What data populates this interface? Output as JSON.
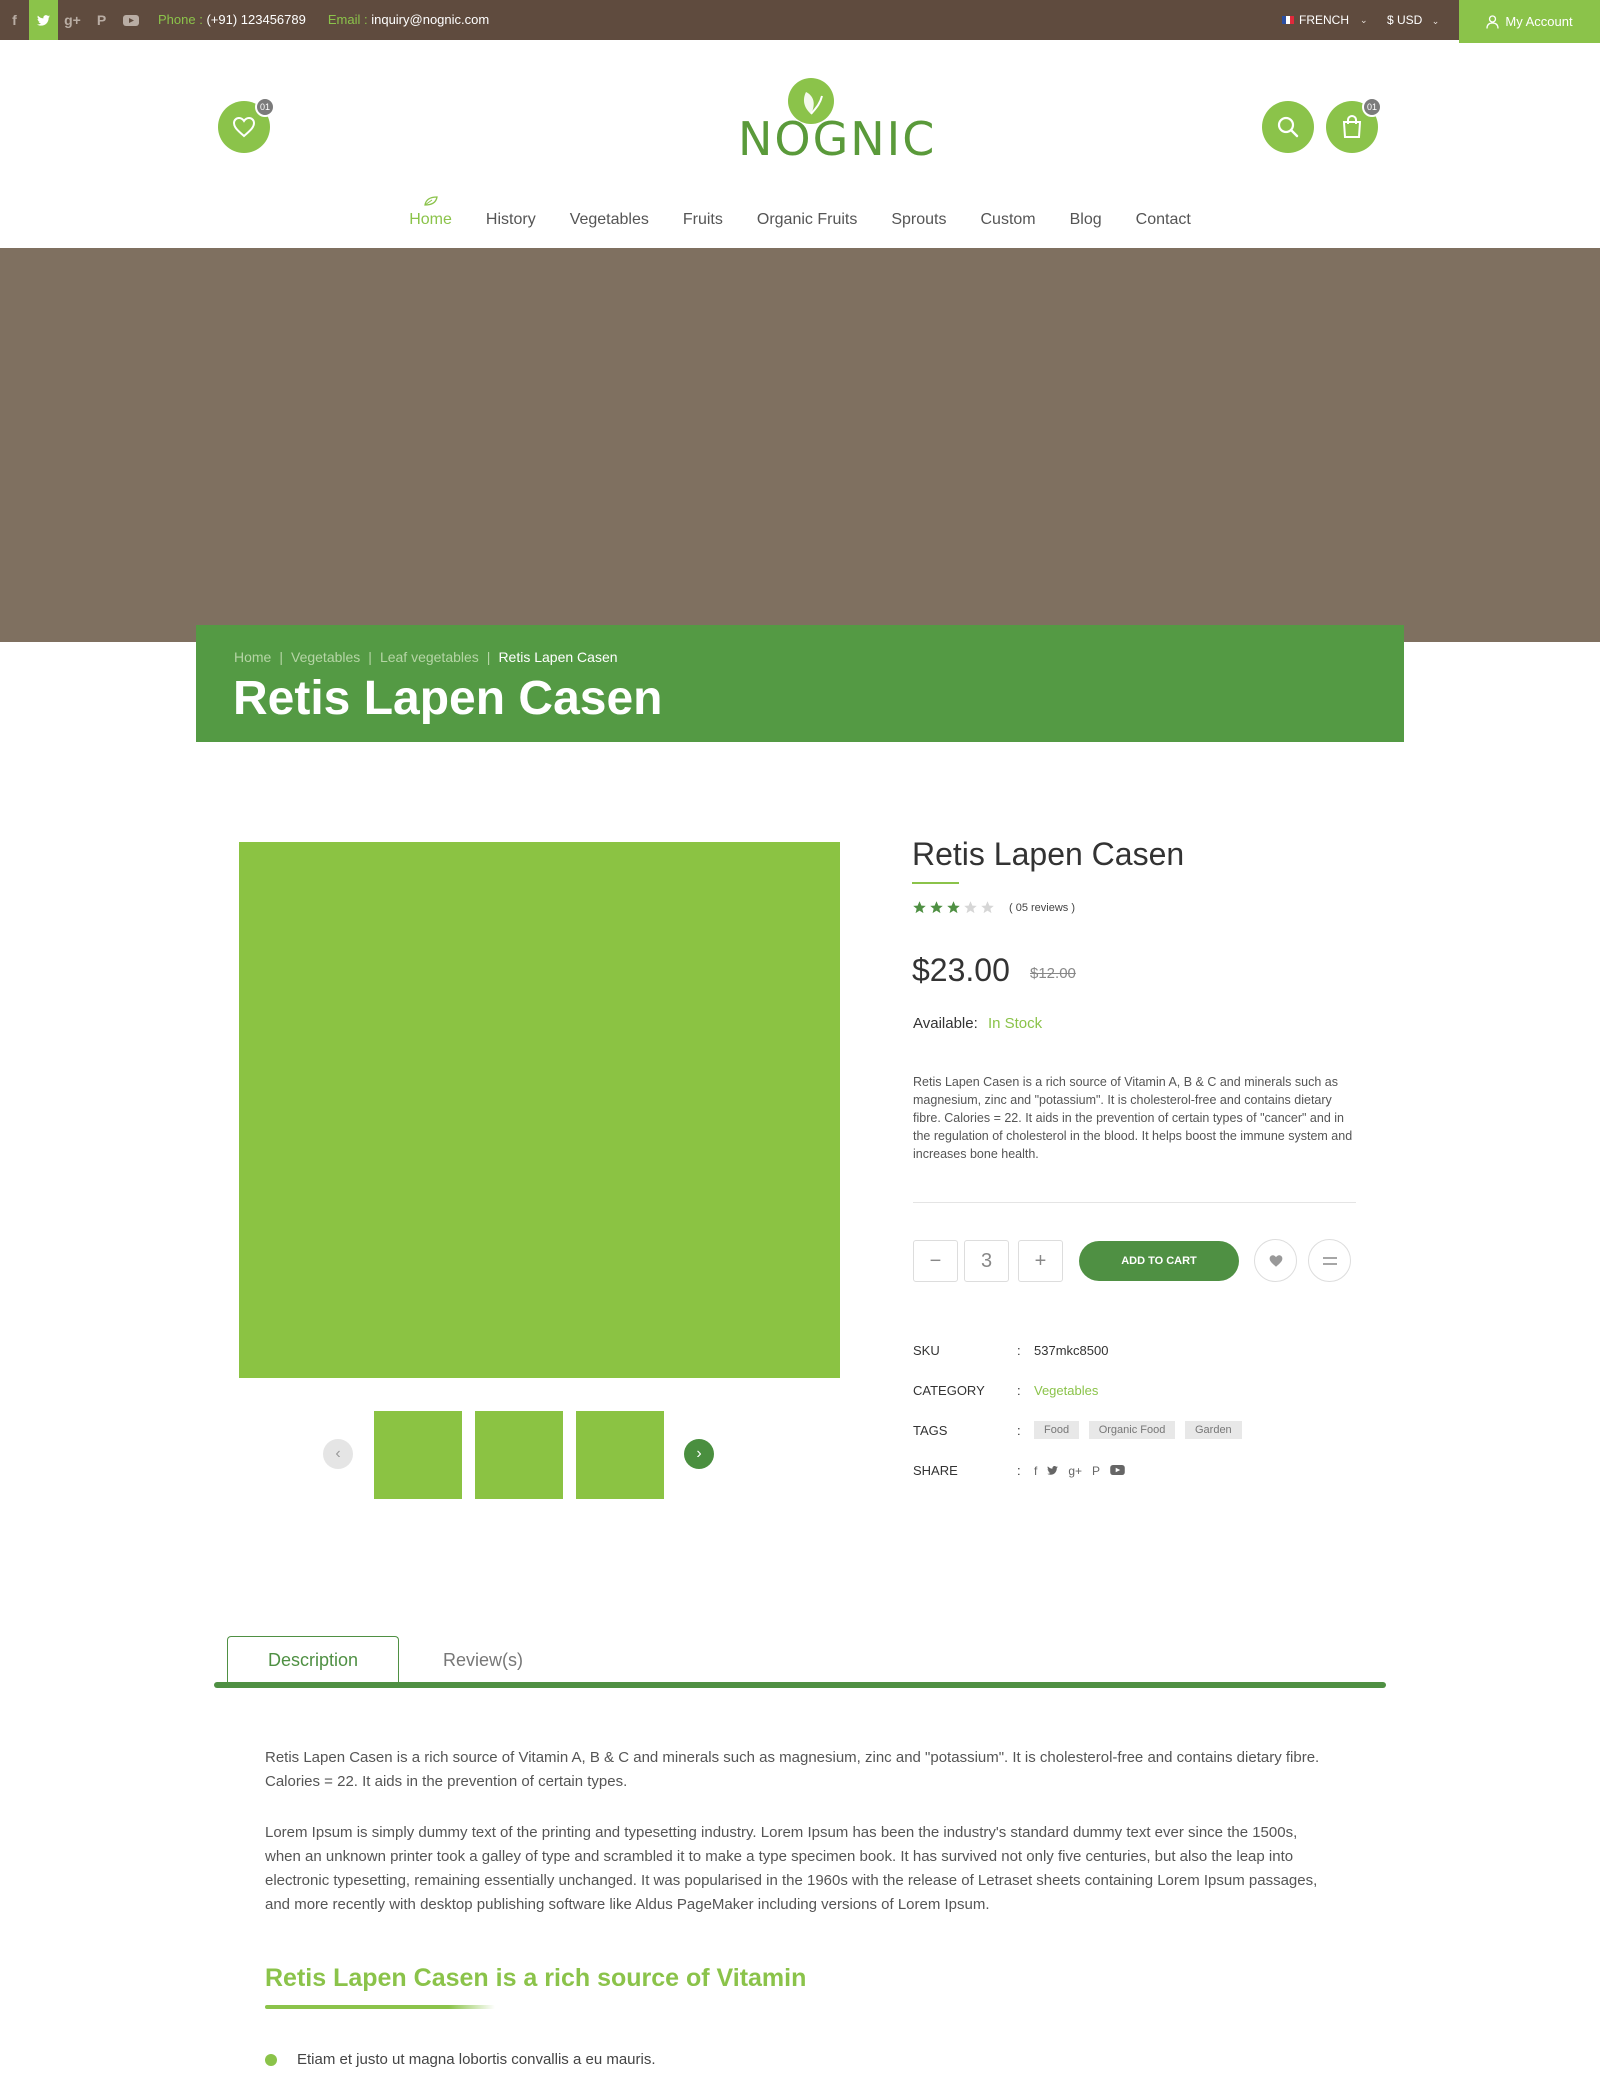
{
  "topbar": {
    "social": [
      "facebook-icon",
      "twitter-icon",
      "google-plus-icon",
      "pinterest-icon",
      "youtube-icon"
    ],
    "phone_label": "Phone :",
    "phone": "(+91) 123456789",
    "email_label": "Email :",
    "email": "inquiry@nognic.com",
    "language": "FRENCH",
    "currency": "$ USD",
    "account": "My Account"
  },
  "header": {
    "wishlist_count": "01",
    "cart_count": "01",
    "logo_text": "NOGNIC"
  },
  "nav": {
    "items": [
      "Home",
      "History",
      "Vegetables",
      "Fruits",
      "Organic Fruits",
      "Sprouts",
      "Custom",
      "Blog",
      "Contact"
    ],
    "active": "Home"
  },
  "breadcrumb": {
    "items": [
      "Home",
      "Vegetables",
      "Leaf vegetables"
    ],
    "current": "Retis Lapen Casen",
    "title": "Retis Lapen Casen"
  },
  "product": {
    "name": "Retis Lapen Casen",
    "rating": 3,
    "rating_max": 5,
    "reviews": "( 05 reviews )",
    "price": "$23.00",
    "old_price": "$12.00",
    "available_label": "Available:",
    "stock": "In Stock",
    "short_description": "Retis Lapen Casen is a rich source of Vitamin A, B & C and minerals such as magnesium, zinc and \"potassium\". It is cholesterol-free and contains dietary fibre. Calories = 22. It aids in the prevention of certain types of \"cancer\" and in the regulation of cholesterol in the blood. It helps boost the immune system and increases bone health.",
    "quantity": "3",
    "minus": "−",
    "plus": "+",
    "add_to_cart": "ADD TO CART",
    "sku_label": "SKU",
    "sku": "537mkc8500",
    "category_label": "CATEGORY",
    "category": "Vegetables",
    "tags_label": "TAGS",
    "tags": [
      "Food",
      "Organic Food",
      "Garden"
    ],
    "share_label": "SHARE",
    "colon": ":"
  },
  "tabs": {
    "description": "Description",
    "reviews": "Review(s)"
  },
  "description": {
    "p1": "Retis Lapen Casen is a rich source of Vitamin A, B & C and minerals such as magnesium, zinc and \"potassium\". It is cholesterol-free and contains dietary fibre. Calories = 22. It aids in the prevention of certain types.",
    "p2": "Lorem Ipsum is simply dummy text of the printing and typesetting industry. Lorem Ipsum has been the industry's standard dummy text ever since the 1500s, when an unknown printer took a galley of type and scrambled it to make a type specimen book. It has survived not only five centuries, but also the leap into electronic typesetting, remaining essentially unchanged. It was popularised in the 1960s with the release of Letraset sheets containing Lorem Ipsum passages, and more recently with desktop publishing software like Aldus PageMaker including versions of Lorem Ipsum.",
    "heading": "Retis Lapen Casen is a rich source of Vitamin",
    "bullet": "Etiam et justo ut magna lobortis convallis a eu mauris."
  },
  "colors": {
    "accent": "#8bc34a",
    "dark_green": "#4f9043",
    "topbar": "#5f4b3e",
    "hero": "#7f7060"
  }
}
